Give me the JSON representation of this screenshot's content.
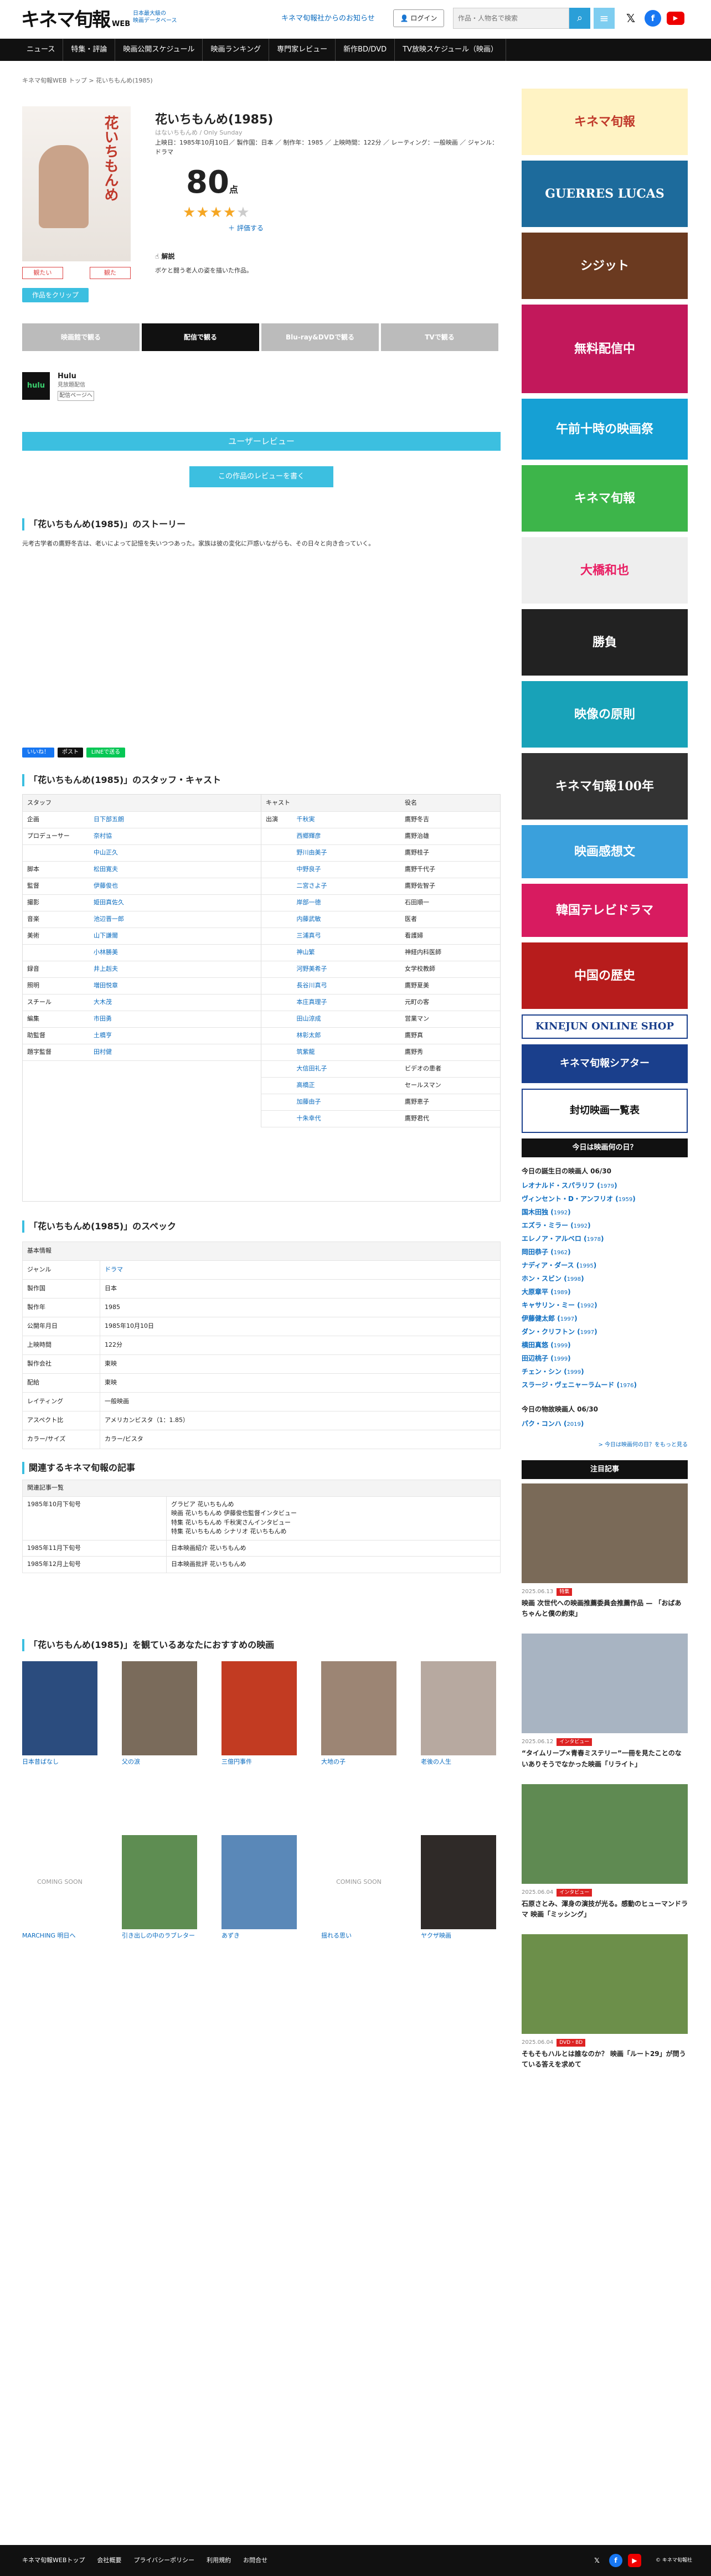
{
  "header": {
    "logo": "キネマ旬報",
    "logo_web": "WEB",
    "tagline1": "日本最大級の",
    "tagline2": "映画データベース",
    "notice": "キネマ旬報社からのお知らせ",
    "login": "ログイン",
    "search_placeholder": "作品・人物名で検索"
  },
  "nav": [
    "ニュース",
    "特集・評論",
    "映画公開スケジュール",
    "映画ランキング",
    "専門家レビュー",
    "新作BD/DVD",
    "TV放映スケジュール（映画）"
  ],
  "breadcrumb": "キネマ旬報WEB トップ  >  花いちもんめ(1985)",
  "film": {
    "title": "花いちもんめ(1985)",
    "title_kana": "はないちもんめ",
    "title_en": "Only Sunday",
    "info": "上映日：1985年10月10日／ 製作国：日本 ／ 制作年：1985 ／ 上映時間：122分 ／ レーティング：一般映画 ／ ジャンル：ドラマ",
    "score": "80",
    "score_unit": "点",
    "stars_on": "★★★★",
    "stars_off": "★",
    "rate_link": "＋ 評価する",
    "kaisetsu": "解説",
    "synopsis": "ボケと闘う老人の姿を描いた作品。",
    "poster_text": "花いちもんめ",
    "btn_view": "観たい",
    "btn_seen": "観た",
    "clip": "作品をクリップ"
  },
  "tabs": [
    "映画館で観る",
    "配信で観る",
    "Blu-ray&DVDで観る",
    "TVで観る"
  ],
  "hulu": {
    "logo": "hulu",
    "name": "Hulu",
    "sub": "見放題配信",
    "more": "配信ページへ"
  },
  "review_bar": "ユーザーレビュー",
  "write_review": "この作品のレビューを書く",
  "story_heading": "「花いちもんめ(1985)」のストーリー",
  "story": "元考古学者の鷹野冬吉は、老いによって記憶を失いつつあった。家族は彼の変化に戸惑いながらも、その日々と向き合っていく。",
  "share": [
    "いいね！",
    "ポスト",
    "LINEで送る"
  ],
  "staff_heading": "「花いちもんめ(1985)」のスタッフ・キャスト",
  "staff_cols": {
    "staff": "スタッフ",
    "cast": "キャスト",
    "role": "役名"
  },
  "staff": [
    [
      "企画",
      "日下部五朗"
    ],
    [
      "プロデューサー",
      "奈村協"
    ],
    [
      "",
      "中山正久"
    ],
    [
      "脚本",
      "松田寛夫"
    ],
    [
      "監督",
      "伊藤俊也"
    ],
    [
      "撮影",
      "姫田真佐久"
    ],
    [
      "音楽",
      "池辺晋一郎"
    ],
    [
      "美術",
      "山下謙爾"
    ],
    [
      "",
      "小林勝美"
    ],
    [
      "録音",
      "井上赳夫"
    ],
    [
      "照明",
      "増田悦章"
    ],
    [
      "スチール",
      "大木茂"
    ],
    [
      "編集",
      "市田勇"
    ],
    [
      "助監督",
      "土橋亨"
    ],
    [
      "題字監督",
      "田村健"
    ]
  ],
  "cast": [
    [
      "出演",
      "千秋実",
      "鷹野冬吉"
    ],
    [
      "",
      "西郷輝彦",
      "鷹野治雄"
    ],
    [
      "",
      "野川由美子",
      "鷹野桂子"
    ],
    [
      "",
      "中野良子",
      "鷹野千代子"
    ],
    [
      "",
      "二宮さよ子",
      "鷹野佐智子"
    ],
    [
      "",
      "岸部一徳",
      "石田順一"
    ],
    [
      "",
      "内藤武敏",
      "医者"
    ],
    [
      "",
      "三浦真弓",
      "看護婦"
    ],
    [
      "",
      "神山繁",
      "神経内科医師"
    ],
    [
      "",
      "河野美希子",
      "女学校教師"
    ],
    [
      "",
      "長谷川真弓",
      "鷹野夏美"
    ],
    [
      "",
      "本庄真理子",
      "元町の客"
    ],
    [
      "",
      "田山涼成",
      "営業マン"
    ],
    [
      "",
      "林彰太郎",
      "鷹野真"
    ],
    [
      "",
      "筑紫龍",
      "鷹野秀"
    ],
    [
      "",
      "大信田礼子",
      "ビデオの患者"
    ],
    [
      "",
      "高橋正",
      "セールスマン"
    ],
    [
      "",
      "加藤由子",
      "鷹野恵子"
    ],
    [
      "",
      "十朱幸代",
      "鷹野君代"
    ]
  ],
  "spec_heading": "「花いちもんめ(1985)」のスペック",
  "spec": [
    [
      "基本情報",
      ""
    ],
    [
      "ジャンル",
      "ドラマ"
    ],
    [
      "製作国",
      "日本"
    ],
    [
      "製作年",
      "1985"
    ],
    [
      "公開年月日",
      "1985年10月10日"
    ],
    [
      "上映時間",
      "122分"
    ],
    [
      "製作会社",
      "東映"
    ],
    [
      "配給",
      "東映"
    ],
    [
      "レイティング",
      "一般映画"
    ],
    [
      "アスペクト比",
      "アメリカンビスタ（1：1.85）"
    ],
    [
      "カラー/サイズ",
      "カラー/ビスタ"
    ]
  ],
  "articles_heading": "関連するキネマ旬報の記事",
  "articles": {
    "header": "関連記事一覧",
    "rows": [
      [
        "1985年10月下旬号",
        "グラビア 花いちもんめ\n映画 花いちもんめ 伊藤俊也監督インタビュー\n特集 花いちもんめ 千秋実さんインタビュー\n特集 花いちもんめ シナリオ 花いちもんめ"
      ],
      [
        "1985年11月下旬号",
        "日本映画紹介 花いちもんめ"
      ],
      [
        "1985年12月上旬号",
        "日本映画批評 花いちもんめ"
      ]
    ]
  },
  "recs_heading": "「花いちもんめ(1985)」を観ているあなたにおすすめの映画",
  "recs": [
    {
      "title": "日本昔ばなし",
      "soon": ""
    },
    {
      "title": "父の涙",
      "soon": ""
    },
    {
      "title": "三億円事件",
      "soon": ""
    },
    {
      "title": "大地の子",
      "soon": ""
    },
    {
      "title": "老後の人生",
      "soon": ""
    },
    {
      "title": "MARCHING 明日へ",
      "soon": "COMING SOON"
    },
    {
      "title": "引き出しの中のラブレター",
      "soon": ""
    },
    {
      "title": "あずき",
      "soon": ""
    },
    {
      "title": "揺れる思い",
      "soon": "COMING SOON"
    },
    {
      "title": "ヤクザ映画",
      "soon": ""
    }
  ],
  "sidebar": {
    "ads": [
      "キネマ旬報",
      "GUERRES LUCAS",
      "シジット",
      "無料配信中",
      "午前十時の映画祭",
      "キネマ旬報",
      "大橋和也",
      "勝負",
      "映像の原則",
      "キネマ旬報100年",
      "映画感想文",
      "韓国テレビドラマ",
      "中国の歴史",
      "KINEJUN ONLINE SHOP",
      "キネマ旬報シアター",
      "封切映画一覧表"
    ],
    "today_heading": "今日は映画何の日？",
    "bday_date": "今日の誕生日の映画人 06/30",
    "bdays": [
      [
        "レオナルド・スパラリフ",
        "1979"
      ],
      [
        "ヴィンセント・D・アンフリオ",
        "1959"
      ],
      [
        "国木田独",
        "1992"
      ],
      [
        "エズラ・ミラー",
        "1992"
      ],
      [
        "エレノア・アルベロ",
        "1978"
      ],
      [
        "岡田恭子",
        "1962"
      ],
      [
        "ナディア・ダース",
        "1995"
      ],
      [
        "ホン・スビン",
        "1998"
      ],
      [
        "大原章平",
        "1989"
      ],
      [
        "キャサリン・ミー",
        "1992"
      ],
      [
        "伊藤健太郎",
        "1997"
      ],
      [
        "ダン・クリフトン",
        "1997"
      ],
      [
        "横田真悠",
        "1999"
      ],
      [
        "田辺桃子",
        "1999"
      ],
      [
        "チェン・シン",
        "1999"
      ],
      [
        "スラージ・ヴェニャーラムード",
        "1976"
      ]
    ],
    "memorial_date": "今日の物故映画人 06/30",
    "memorials": [
      [
        "パク・コンハ",
        "2019"
      ]
    ],
    "more": "> 今日は映画何の日？をもっと見る",
    "featured_heading": "注目記事",
    "featured": [
      {
        "date": "2025.06.13",
        "badge": "特集",
        "title": "映画 次世代への映画推薦委員会推薦作品 — 「おばあちゃんと僕の約束」"
      },
      {
        "date": "2025.06.12",
        "badge": "インタビュー",
        "title": "“タイムリープ×青春ミステリー”一冊を見たことのないありそうでなかった映画「リライト」"
      },
      {
        "date": "2025.06.04",
        "badge": "インタビュー",
        "title": "石原さとみ、渾身の演技が光る。感動のヒューマンドラマ 映画「ミッシング」"
      },
      {
        "date": "2025.06.04",
        "badge": "DVD・BD",
        "title": "そもそもハルとは誰なのか？ 映画「ルート29」が問うている答えを求めて"
      }
    ]
  },
  "footer": {
    "links": [
      "キネマ旬報WEBトップ",
      "会社概要",
      "プライバシーポリシー",
      "利用規約",
      "お問合せ"
    ],
    "copy": "© キネマ旬報社"
  }
}
